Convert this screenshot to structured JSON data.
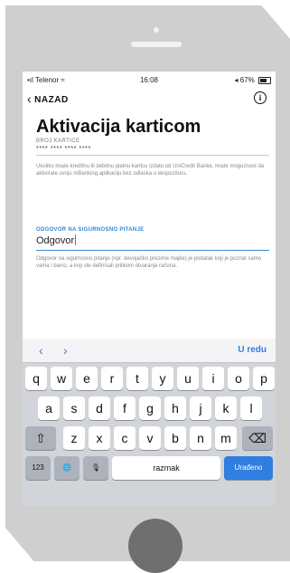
{
  "status": {
    "carrier": "Telenor",
    "time": "16:08",
    "battery": "67%"
  },
  "nav": {
    "back_label": "NAZAD",
    "info_icon": "info-icon"
  },
  "page": {
    "title": "Aktivacija karticom",
    "card_label": "BROJ KARTICE",
    "card_value": "**** **** **** ****",
    "card_help": "Ukoliko imate kreditnu ili debitnu platnu karticu izdatu od UniCredit Banke, imate mogućnost da aktivirate svoju mBanking aplikaciju bez odlaska u ekspozituru.",
    "question_label": "ODGOVOR NA SIGURNOSNO PITANJE",
    "answer_value": "Odgovor",
    "answer_help": "Odgovor na sigurnosno pitanje (npr. devojačko prezime majke) je podatak koji je poznat samo vama i banci, a koji ste definisali prilikom otvaranja računa."
  },
  "keyboard": {
    "prev": "‹",
    "next": "›",
    "done": "U redu",
    "row1": [
      "q",
      "w",
      "e",
      "r",
      "t",
      "y",
      "u",
      "i",
      "o",
      "p"
    ],
    "row2": [
      "a",
      "s",
      "d",
      "f",
      "g",
      "h",
      "j",
      "k",
      "l"
    ],
    "row3": [
      "z",
      "x",
      "c",
      "v",
      "b",
      "n",
      "m"
    ],
    "shift": "⇧",
    "delete": "⌫",
    "numbers": "123",
    "globe": "🌐",
    "mic": "🎙",
    "space": "razmak",
    "return": "Urađeno"
  }
}
